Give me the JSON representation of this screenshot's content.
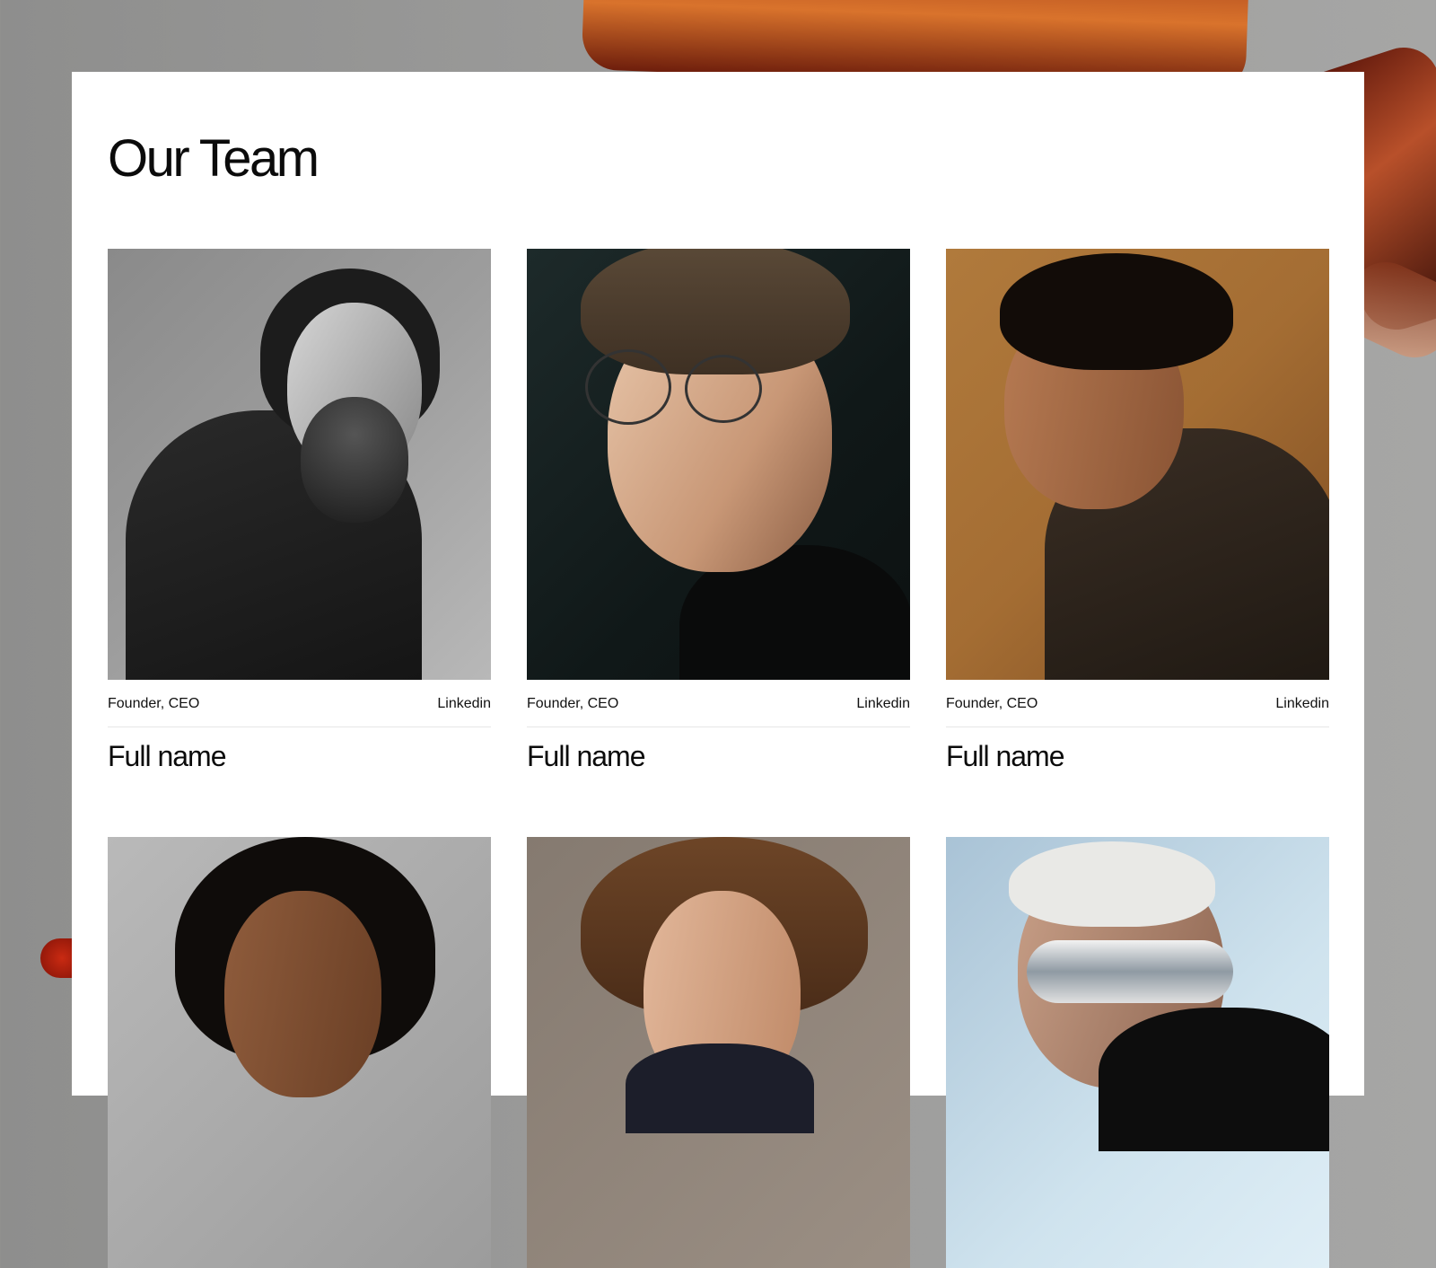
{
  "page": {
    "title": "Our Team"
  },
  "members": [
    {
      "role": "Founder, CEO",
      "link_label": "Linkedin",
      "name": "Full name",
      "photo": "portrait-bearded-man-bw"
    },
    {
      "role": "Founder, CEO",
      "link_label": "Linkedin",
      "name": "Full name",
      "photo": "portrait-man-glasses"
    },
    {
      "role": "Founder, CEO",
      "link_label": "Linkedin",
      "name": "Full name",
      "photo": "portrait-man-profile-amber"
    },
    {
      "photo": "portrait-man-long-hair"
    },
    {
      "photo": "portrait-man-curly-hair"
    },
    {
      "photo": "portrait-man-sunglasses"
    }
  ],
  "colors": {
    "panel": "#ffffff",
    "text": "#0b0b0b",
    "divider": "#e6e6e6",
    "backdrop": "#9a9a99",
    "accent_orange": "#d9732c"
  }
}
